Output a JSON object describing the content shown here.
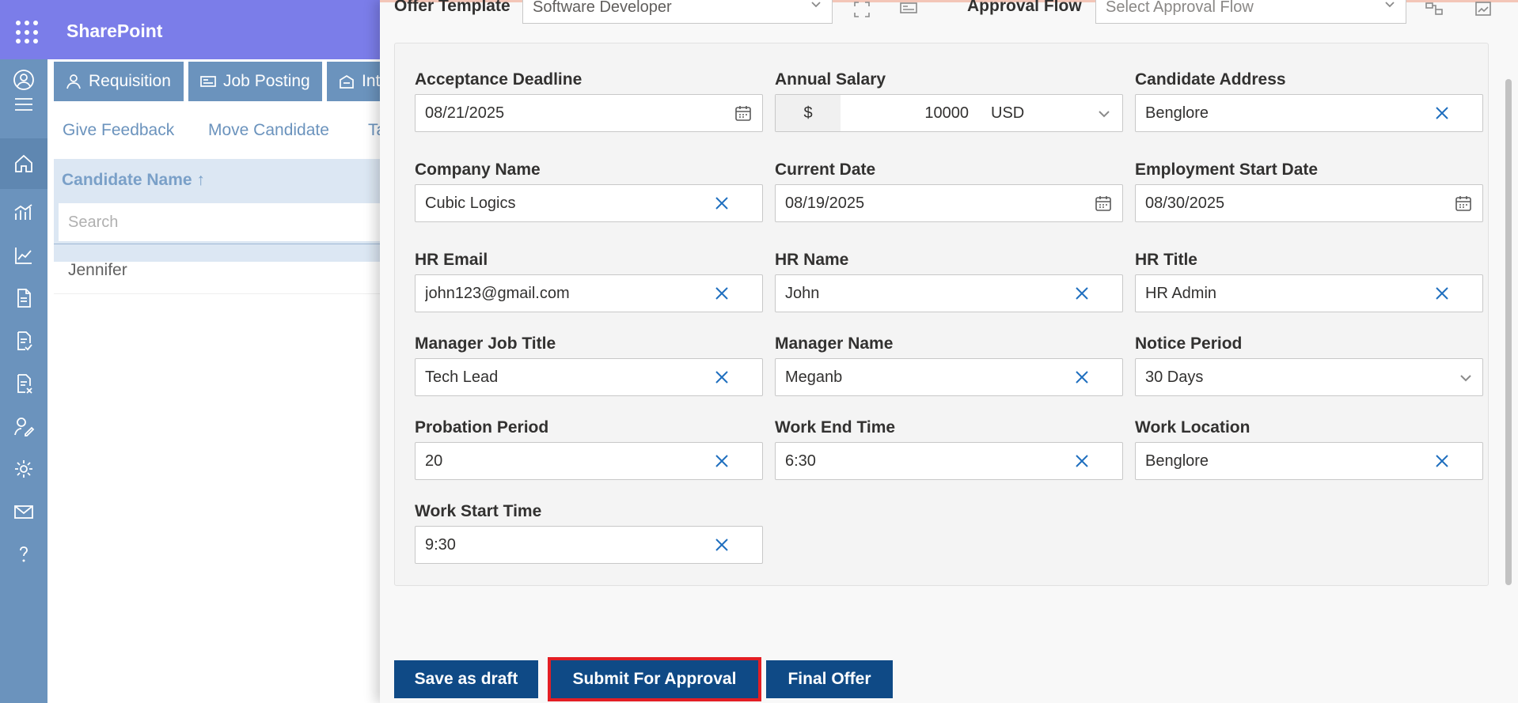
{
  "app": {
    "title": "SharePoint"
  },
  "tabs": [
    {
      "label": "Requisition",
      "icon": "person-icon"
    },
    {
      "label": "Job Posting",
      "icon": "newspaper-icon"
    },
    {
      "label": "Int",
      "icon": "interview-icon"
    }
  ],
  "actions": [
    {
      "label": "Give Feedback"
    },
    {
      "label": "Move Candidate"
    },
    {
      "label": "Ta"
    }
  ],
  "candidates": {
    "column_header": "Candidate Name ↑",
    "search_placeholder": "Search",
    "rows": [
      "Jennifer"
    ]
  },
  "panel": {
    "offer_template_label": "Offer Template",
    "offer_template_value": "Software Developer",
    "approval_flow_label": "Approval Flow",
    "approval_flow_placeholder": "Select Approval Flow"
  },
  "fields": {
    "acceptance_deadline": {
      "label": "Acceptance Deadline",
      "value": "08/21/2025"
    },
    "annual_salary": {
      "label": "Annual Salary",
      "symbol": "$",
      "amount": "10000",
      "currency": "USD"
    },
    "candidate_address": {
      "label": "Candidate Address",
      "value": "Benglore"
    },
    "company_name": {
      "label": "Company Name",
      "value": "Cubic Logics"
    },
    "current_date": {
      "label": "Current Date",
      "value": "08/19/2025"
    },
    "employment_start_date": {
      "label": "Employment Start Date",
      "value": "08/30/2025"
    },
    "hr_email": {
      "label": "HR Email",
      "value": "john123@gmail.com"
    },
    "hr_name": {
      "label": "HR Name",
      "value": "John"
    },
    "hr_title": {
      "label": "HR Title",
      "value": "HR Admin"
    },
    "manager_job_title": {
      "label": "Manager Job Title",
      "value": "Tech Lead"
    },
    "manager_name": {
      "label": "Manager Name",
      "value": "Meganb"
    },
    "notice_period": {
      "label": "Notice Period",
      "value": "30 Days"
    },
    "probation_period": {
      "label": "Probation Period",
      "value": "20"
    },
    "work_end_time": {
      "label": "Work End Time",
      "value": "6:30"
    },
    "work_location": {
      "label": "Work Location",
      "value": "Benglore"
    },
    "work_start_time": {
      "label": "Work Start Time",
      "value": "9:30"
    }
  },
  "buttons": {
    "save_draft": "Save as draft",
    "submit_approval": "Submit For Approval",
    "final_offer": "Final Offer"
  },
  "colors": {
    "topbar": "#7b7de9",
    "rail": "#6b93bd",
    "primary_button": "#0f4a86",
    "highlight_outline": "#e31e24",
    "clear_icon": "#1f6fbf"
  }
}
